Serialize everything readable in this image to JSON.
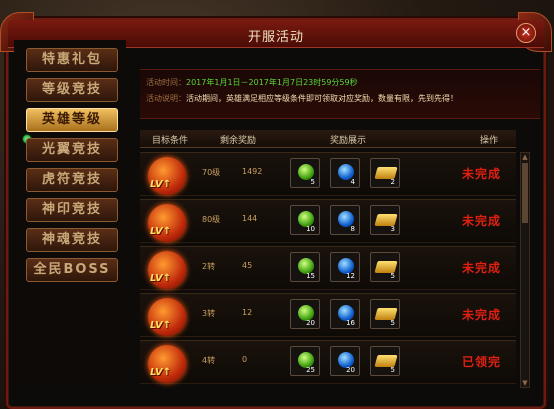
{
  "window": {
    "title": "开服活动",
    "close_label": "×"
  },
  "sidebar": {
    "items": [
      {
        "label": "特惠礼包"
      },
      {
        "label": "等级竞技"
      },
      {
        "label": "英雄等级"
      },
      {
        "label": "光翼竞技"
      },
      {
        "label": "虎符竞技"
      },
      {
        "label": "神印竞技"
      },
      {
        "label": "神魂竞技"
      },
      {
        "label": "全民BOSS"
      }
    ],
    "active_index": 2
  },
  "info": {
    "time_key": "活动时间：",
    "time_value": "2017年1月1日－2017年1月7日23时59分59秒",
    "desc_key": "活动说明：",
    "desc_value": "活动期间，英雄满足相应等级条件即可领取对应奖励，数量有限，先到先得！"
  },
  "table": {
    "headers": {
      "target": "目标条件",
      "remain": "剩余奖励",
      "reward": "奖励展示",
      "op": "操作"
    },
    "rows": [
      {
        "badge": "LV↑",
        "cond": "70级",
        "remain": "1492",
        "rewards": [
          "5",
          "4",
          "2"
        ],
        "op": "未完成"
      },
      {
        "badge": "LV↑",
        "cond": "80级",
        "remain": "144",
        "rewards": [
          "10",
          "8",
          "3"
        ],
        "op": "未完成"
      },
      {
        "badge": "LV↑",
        "cond": "2转",
        "remain": "45",
        "rewards": [
          "15",
          "12",
          "5"
        ],
        "op": "未完成"
      },
      {
        "badge": "LV↑",
        "cond": "3转",
        "remain": "12",
        "rewards": [
          "20",
          "16",
          "5"
        ],
        "op": "未完成"
      },
      {
        "badge": "LV↑",
        "cond": "4转",
        "remain": "0",
        "rewards": [
          "25",
          "20",
          "5"
        ],
        "op": "已领完"
      }
    ]
  },
  "colors": {
    "accent": "#e02010",
    "active_tab": "#f0c060",
    "frame": "#6b1b12"
  }
}
